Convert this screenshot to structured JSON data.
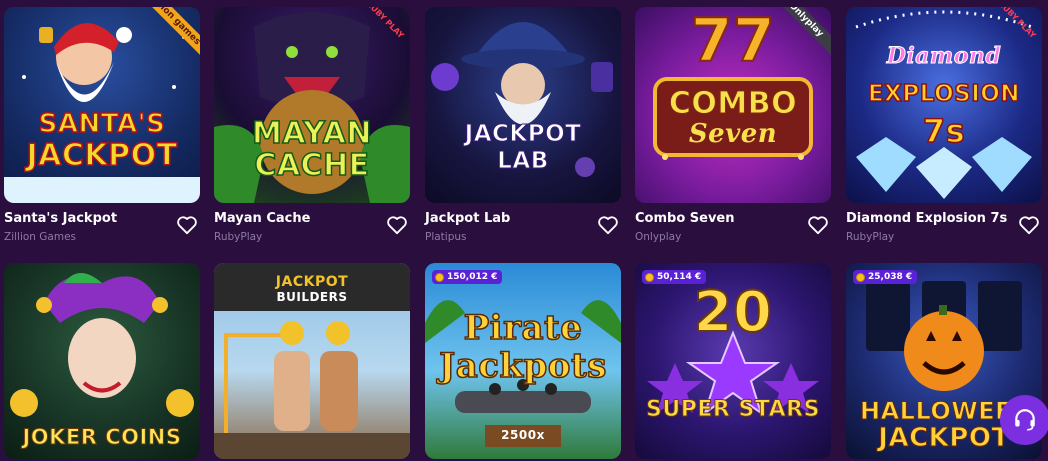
{
  "games": [
    {
      "name": "Santa's Jackpot",
      "provider": "Zillion Games",
      "art_line1": "SANTA'S",
      "art_line2": "JACKPOT",
      "ribbon": "zillion games"
    },
    {
      "name": "Mayan Cache",
      "provider": "RubyPlay",
      "art_line1": "MAYAN",
      "art_line2": "CACHE",
      "ribbon": "RUBY PLAY"
    },
    {
      "name": "Jackpot Lab",
      "provider": "Platipus",
      "art_line1": "JACKPOT",
      "art_line2": "LAB"
    },
    {
      "name": "Combo Seven",
      "provider": "Onlyplay",
      "art_line1": "COMBO",
      "art_line2": "Seven",
      "art_seven": "77",
      "ribbon": "Onlyplay"
    },
    {
      "name": "Diamond Explosion 7s",
      "provider": "RubyPlay",
      "art_line1": "Diamond",
      "art_line2": "EXPLOSION",
      "art_line3": "7s",
      "ribbon": "RUBY PLAY"
    },
    {
      "art_line1": "JOKER COINS"
    },
    {
      "art_line1": "JACKPOT",
      "art_line2": "BUILDERS"
    },
    {
      "jackpot": "150,012 €",
      "art_line1": "Pirate",
      "art_line2": "Jackpots",
      "art_line3": "2500x"
    },
    {
      "jackpot": "50,114 €",
      "art_line1": "20",
      "art_line2": "SUPER STARS"
    },
    {
      "jackpot": "25,038 €",
      "art_line1": "HALLOWEE",
      "art_line2": "JACKPOT"
    }
  ],
  "icons": {
    "favorite": "heart-outline-icon",
    "support": "headset-icon",
    "jackpot": "coin-icon"
  },
  "colors": {
    "background": "#2a0f3e",
    "provider_text": "#8f7aa3",
    "support_button": "#7b2fe0",
    "jackpot_badge": "#5b21d6"
  }
}
